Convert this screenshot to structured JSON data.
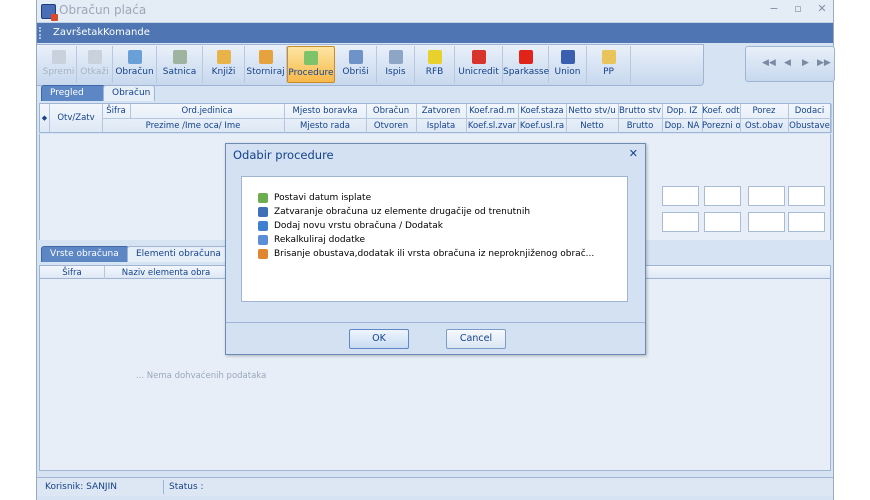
{
  "window": {
    "title": "Obračun plaća"
  },
  "menu": [
    "Završetak",
    "Komande"
  ],
  "toolbar": [
    {
      "label": "Spremi",
      "icon": "save-icon",
      "disabled": true,
      "color": "#c9d1dc"
    },
    {
      "label": "Otkaži",
      "icon": "cancel-icon",
      "disabled": true,
      "color": "#c9d1dc"
    },
    {
      "label": "Obračun",
      "icon": "calculation-icon",
      "disabled": false,
      "color": "#6aa0d8"
    },
    {
      "label": "Satnica",
      "icon": "clock-icon",
      "disabled": false,
      "color": "#9fb4a0"
    },
    {
      "label": "Knjiži",
      "icon": "book-icon",
      "disabled": false,
      "color": "#e8b44a"
    },
    {
      "label": "Storniraj",
      "icon": "reverse-icon",
      "disabled": false,
      "color": "#e6a23c"
    },
    {
      "label": "Procedure",
      "icon": "procedure-icon",
      "disabled": false,
      "color": "#7cc36a"
    },
    {
      "label": "Obriši",
      "icon": "delete-icon",
      "disabled": false,
      "color": "#6f93c8"
    },
    {
      "label": "Ispis",
      "icon": "print-icon",
      "disabled": false,
      "color": "#8ea6c6"
    },
    {
      "label": "RFB",
      "icon": "rfb-icon",
      "disabled": false,
      "color": "#e8d12c"
    },
    {
      "label": "Unicredit",
      "icon": "unicredit-icon",
      "disabled": false,
      "color": "#d8342b"
    },
    {
      "label": "Sparkasse",
      "icon": "sparkasse-icon",
      "disabled": false,
      "color": "#e2231a"
    },
    {
      "label": "Union",
      "icon": "union-icon",
      "disabled": false,
      "color": "#3a5fb0"
    },
    {
      "label": "PP",
      "icon": "folder-icon",
      "disabled": false,
      "color": "#e9c45a"
    }
  ],
  "nav": [
    "◀◀",
    "◀",
    "▶",
    "▶▶"
  ],
  "tabs_top": [
    "Pregled",
    "Obračun"
  ],
  "grid": {
    "corner": "Otv/Zatv",
    "row1": [
      "Šifra",
      "Ord.jedinica",
      "Mjesto boravka",
      "Obračun",
      "Zatvoren",
      "Koef.rad.m",
      "Koef.staza",
      "Netto stv/u",
      "Brutto stv",
      "Dop. IZ",
      "Koef. odt",
      "Porez",
      "Dodaci"
    ],
    "row2": [
      "Prezime /Ime oca/ Ime",
      "Mjesto rada",
      "Otvoren",
      "Isplata",
      "Koef.sl.zvar",
      "Koef.usl.ra",
      "Netto",
      "Brutto",
      "Dop. NA",
      "Porezni o",
      "Ost.obav",
      "Obustave"
    ]
  },
  "tabs_bottom": [
    "Vrste obračuna",
    "Elementi obračuna"
  ],
  "grid2": {
    "cols": [
      "Šifra",
      "Naziv elementa obra"
    ],
    "empty": "... Nema dohvaćenih podataka"
  },
  "status": {
    "user": "Korisnik: SANJIN",
    "status": "Status :"
  },
  "dialog": {
    "title": "Odabir procedure",
    "items": [
      {
        "label": "Postavi datum isplate",
        "icon": "set-date-icon",
        "color": "#6cae4f"
      },
      {
        "label": "Zatvaranje obračuna uz elemente drugačije od trenutnih",
        "icon": "close-calc-icon",
        "color": "#3f6fb5"
      },
      {
        "label": "Dodaj novu vrstu obračuna / Dodatak",
        "icon": "add-icon",
        "color": "#3f7fd0"
      },
      {
        "label": "Rekalkuliraj dodatke",
        "icon": "recalc-icon",
        "color": "#5b8ed6"
      },
      {
        "label": "Brisanje obustava,dodatak ili vrsta obračuna iz neproknjiženog obrač...",
        "icon": "erase-icon",
        "color": "#e0862e"
      }
    ],
    "ok": "OK",
    "cancel": "Cancel"
  }
}
